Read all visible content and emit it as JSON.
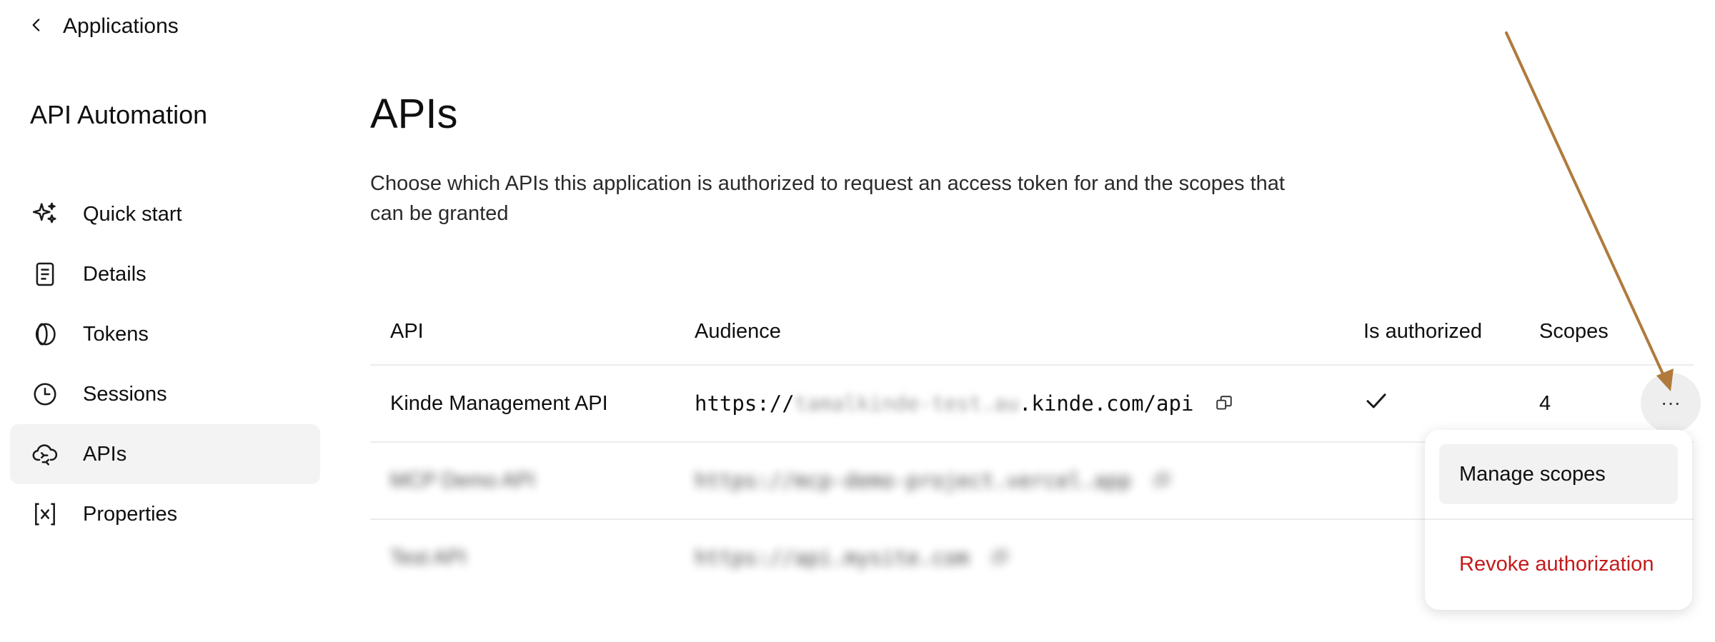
{
  "back": {
    "label": "Applications"
  },
  "sidebar": {
    "app_title": "API Automation",
    "items": [
      {
        "label": "Quick start",
        "icon": "sparkles-icon"
      },
      {
        "label": "Details",
        "icon": "document-icon"
      },
      {
        "label": "Tokens",
        "icon": "token-icon"
      },
      {
        "label": "Sessions",
        "icon": "clock-icon"
      },
      {
        "label": "APIs",
        "icon": "cloud-sync-icon",
        "active": true
      },
      {
        "label": "Properties",
        "icon": "variable-icon"
      }
    ]
  },
  "main": {
    "title": "APIs",
    "description": "Choose which APIs this application is authorized to request an access token for and the scopes that can be granted"
  },
  "table": {
    "headers": {
      "api": "API",
      "audience": "Audience",
      "is_authorized": "Is authorized",
      "scopes": "Scopes"
    },
    "rows": [
      {
        "api": "Kinde Management API",
        "audience_prefix": "https://",
        "audience_redacted": "tamalkinde-test.au",
        "audience_suffix": ".kinde.com/api",
        "scopes": "4"
      },
      {
        "api": "MCP Demo API",
        "audience": "https://mcp-demo-project.vercel.app"
      },
      {
        "api": "Test API",
        "audience": "https://api.mysite.com"
      }
    ]
  },
  "row_actions": {
    "more_label": "···"
  },
  "menu": {
    "manage_scopes": "Manage scopes",
    "revoke_authorization": "Revoke authorization"
  },
  "colors": {
    "danger": "#c41a1a",
    "active_bg": "#f3f3f3",
    "annotation_arrow": "#b07a3c"
  }
}
